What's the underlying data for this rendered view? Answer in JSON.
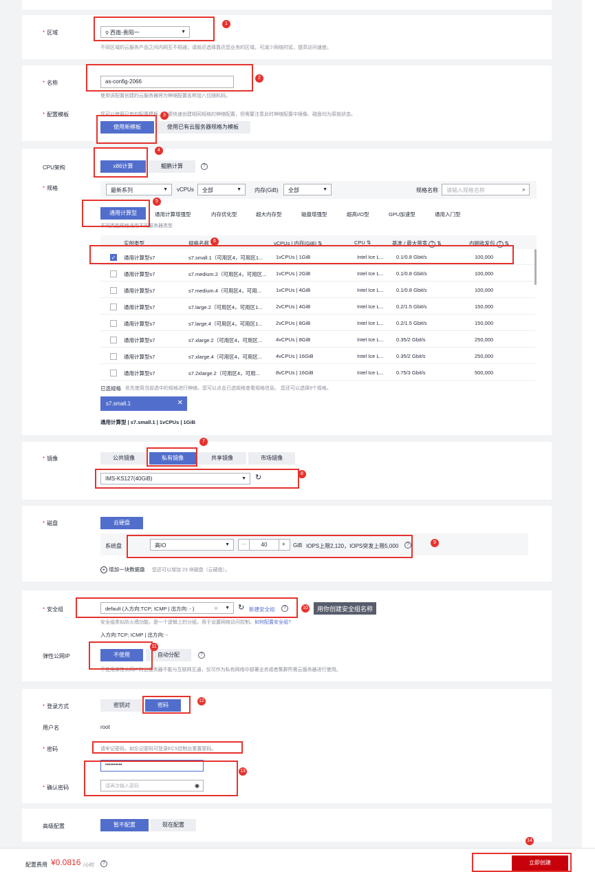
{
  "region": {
    "label": "区域",
    "value": "西南-贵阳一",
    "hint": "不同区域的云服务产品之间内网互不相通；请就近选择靠近您业务的区域，可减少网络时延，提高访问速度。"
  },
  "name": {
    "label": "名称",
    "value": "as-config-2066",
    "hint": "使用该配置创建的云服务器将为伸缩配置名称加八位随机码。"
  },
  "template": {
    "label": "配置模板",
    "hint": "您可以使用已有的配置模板，以便快速创建相同规格的伸缩配置，但需要注意此时伸缩配置中镜像、磁盘均为原始状态。",
    "btn_new": "使用新模板",
    "btn_existing": "使用已有云服务器规格为模板"
  },
  "cpu": {
    "label": "CPU架构",
    "x86": "x86计算",
    "kunpeng": "鲲鹏计算"
  },
  "spec": {
    "label": "规格",
    "filter_series": "最新系列",
    "filter_vcpus_label": "vCPUs",
    "filter_vcpus": "全部",
    "filter_mem_label": "内存(GiB)",
    "filter_mem": "全部",
    "name_label": "规格名称",
    "search_placeholder": "请输入规格名称",
    "tabs": [
      "通用计算型",
      "通用计算增强型",
      "内存优化型",
      "超大内存型",
      "磁盘增强型",
      "超高I/O型",
      "GPU加速型",
      "通用入门型"
    ],
    "tab_hint": "不同类型规格适用不同服务器类型",
    "columns": {
      "type": "实例类型",
      "name": "规格名称",
      "vcpu": "vCPUs | 内存(GiB)",
      "cpu": "CPU",
      "bw": "基准 / 最大带宽",
      "pps": "内网收发包"
    },
    "rows": [
      {
        "type": "通用计算型s7",
        "name": "s7.small.1（可用区4，可用区1...",
        "vcpu": "1vCPUs | 1GiB",
        "cpu": "Intel Ice L...",
        "bw": "0.1/0.8 Gbit/s",
        "pps": "100,000",
        "checked": true
      },
      {
        "type": "通用计算型s7",
        "name": "s7.medium.2（可用区4，可用区...",
        "vcpu": "1vCPUs | 2GiB",
        "cpu": "Intel Ice L...",
        "bw": "0.1/0.8 Gbit/s",
        "pps": "100,000",
        "checked": false
      },
      {
        "type": "通用计算型s7",
        "name": "s7.medium.4（可用区4，可用...",
        "vcpu": "1vCPUs | 4GiB",
        "cpu": "Intel Ice L...",
        "bw": "0.1/0.8 Gbit/s",
        "pps": "100,000",
        "checked": false
      },
      {
        "type": "通用计算型s7",
        "name": "s7.large.2（可用区4，可用区1...",
        "vcpu": "2vCPUs | 4GiB",
        "cpu": "Intel Ice L...",
        "bw": "0.2/1.5 Gbit/s",
        "pps": "150,000",
        "checked": false
      },
      {
        "type": "通用计算型s7",
        "name": "s7.large.4（可用区4，可用区1...",
        "vcpu": "2vCPUs | 8GiB",
        "cpu": "Intel Ice L...",
        "bw": "0.2/1.5 Gbit/s",
        "pps": "150,000",
        "checked": false
      },
      {
        "type": "通用计算型s7",
        "name": "s7.xlarge.2（可用区4，可用区...",
        "vcpu": "4vCPUs | 8GiB",
        "cpu": "Intel Ice L...",
        "bw": "0.35/2 Gbit/s",
        "pps": "250,000",
        "checked": false
      },
      {
        "type": "通用计算型s7",
        "name": "s7.xlarge.4（可用区4，可用区...",
        "vcpu": "4vCPUs | 16GiB",
        "cpu": "Intel Ice L...",
        "bw": "0.35/2 Gbit/s",
        "pps": "250,000",
        "checked": false
      },
      {
        "type": "通用计算型s7",
        "name": "s7.2xlarge.2（可用区4，可用...",
        "vcpu": "8vCPUs | 16GiB",
        "cpu": "Intel Ice L...",
        "bw": "0.75/3 Gbit/s",
        "pps": "500,000",
        "checked": false
      }
    ],
    "selected_label": "已选规格",
    "selected_hint": "优先使用当前选中的规格进行伸缩，您可以点击已选规格查看规格信息。 您还可以选择9个规格。",
    "selected_tag": "s7.small.1",
    "summary": "通用计算型 | s7.small.1 | 1vCPUs | 1GiB"
  },
  "image": {
    "label": "镜像",
    "tabs": [
      "公共镜像",
      "私有镜像",
      "共享镜像",
      "市场镜像"
    ],
    "value": "IMS-KS127(40GiB)"
  },
  "disk": {
    "label": "磁盘",
    "type_btn": "云硬盘",
    "sys_label": "系统盘",
    "disk_type": "高IO",
    "size": "40",
    "unit": "GiB",
    "iops": "IOPS上限2,120，IOPS突发上限5,000",
    "add_label": "增加一块数据盘",
    "add_hint": "您还可以增加 23 块磁盘（云硬盘）。"
  },
  "security": {
    "label": "安全组",
    "value": "default (入方向:TCP; ICMP | 出方向: - )",
    "new_link": "新建安全组",
    "hint": "安全组类似防火墙功能，是一个逻辑上的分组，用于设置网络访问控制。",
    "hint_link": "如何配置安全组?",
    "rules": "入方向:TCP; ICMP | 出方向: -",
    "tooltip": "用你创建安全组名称"
  },
  "eip": {
    "label": "弹性公网IP",
    "no": "不使用",
    "auto": "自动分配",
    "hint": "不使用弹性公网IP的云服务器不能与互联网互通，仅可作为私有网络中部署业务或者集群所需云服务器进行使用。"
  },
  "login": {
    "label": "登录方式",
    "keypair": "密钥对",
    "password": "密码",
    "user_label": "用户名",
    "user": "root",
    "pwd_label": "密码",
    "pwd_hint": "请牢记密码，如忘记密码可登录ECS控制台重置密码。",
    "pwd_value": "••••••••••",
    "confirm_label": "确认密码",
    "confirm_placeholder": "请再次输入密码"
  },
  "advanced": {
    "label": "高级配置",
    "no": "暂不配置",
    "now": "现在配置"
  },
  "footer": {
    "price_label": "配置费用",
    "price": "¥0.0816",
    "price_unit": "/小时",
    "create": "立即创建"
  },
  "markers": [
    "1",
    "2",
    "3",
    "4",
    "5",
    "6",
    "7",
    "8",
    "9",
    "10",
    "11",
    "12",
    "13",
    "14"
  ]
}
